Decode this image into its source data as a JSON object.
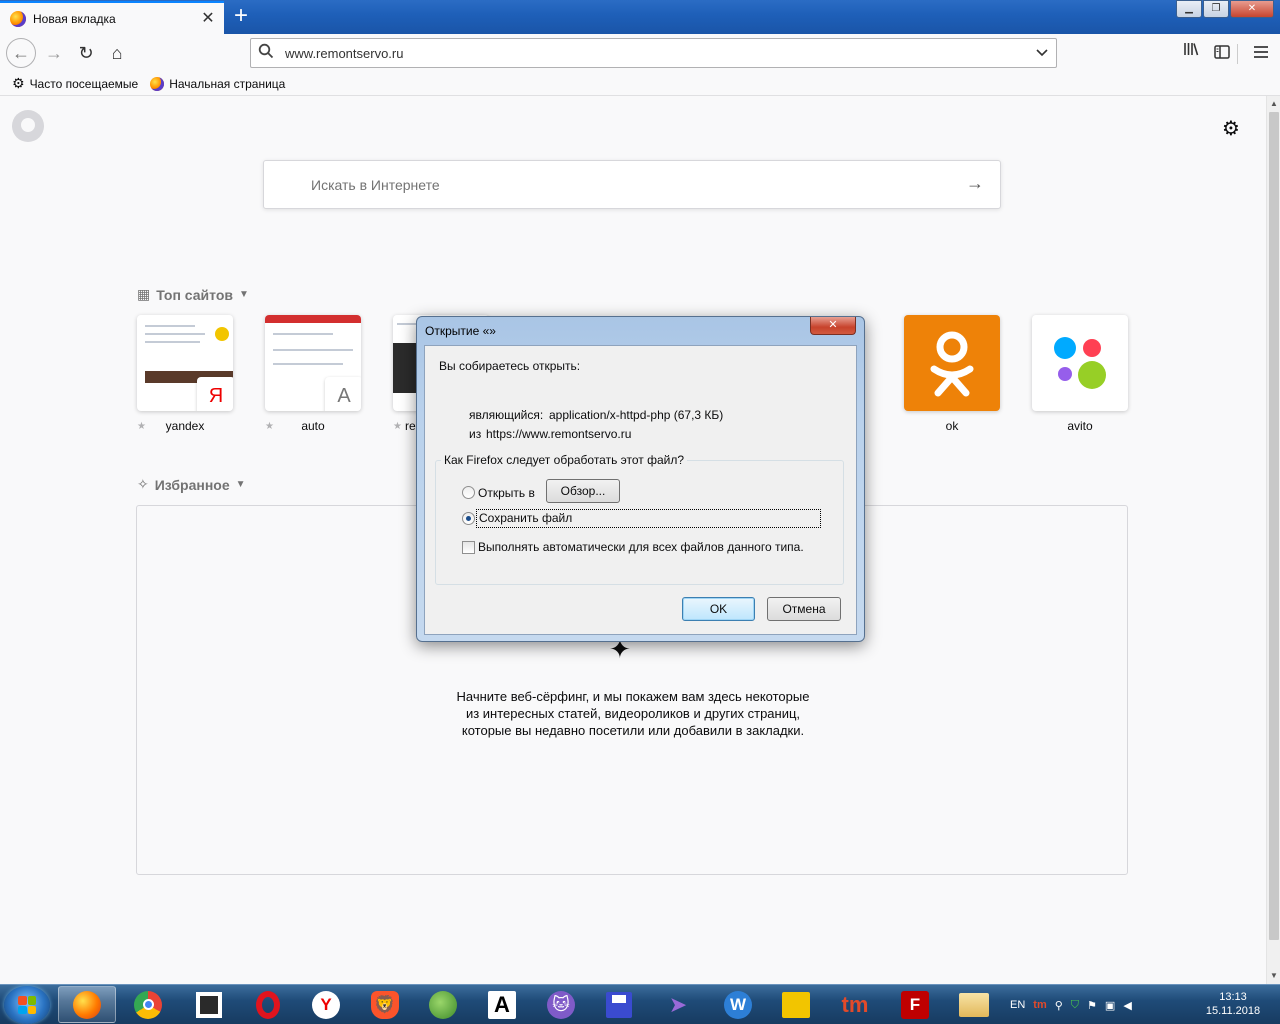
{
  "browser": {
    "tab_title": "Новая вкладка",
    "tab_close": "✕",
    "new_tab": "+",
    "url": "www.remontservo.ru",
    "bookmarks": [
      {
        "label": "Часто посещаемые",
        "icon": "gear-icon"
      },
      {
        "label": "Начальная страница",
        "icon": "firefox-icon"
      }
    ]
  },
  "newtab": {
    "search_placeholder": "Искать в Интернете",
    "top_sites_title": "Топ сайтов",
    "top_sites": [
      {
        "label": "yandex",
        "badge": "Я"
      },
      {
        "label": "auto",
        "badge": "A"
      },
      {
        "label": "re"
      },
      {
        "label": "ok"
      },
      {
        "label": "avito"
      }
    ],
    "favorites_title": "Избранное",
    "favorites_empty_text": "Начните веб-сёрфинг, и мы покажем вам здесь некоторые из интересных статей, видеороликов и других страниц, которые вы недавно посетили или добавили в закладки."
  },
  "dialog": {
    "title": "Открытие «»",
    "close": "✕",
    "heading": "Вы собираетесь открыть:",
    "type_label": "являющийся:",
    "type_value": "application/x-httpd-php (67,3 КБ)",
    "from_label": "из",
    "from_value": "https://www.remontservo.ru",
    "group_label": "Как Firefox следует обработать этот файл?",
    "open_with_label": "Открыть в",
    "browse_button": "Обзор...",
    "save_label": "Сохранить файл",
    "auto_label": "Выполнять автоматически для всех файлов данного типа.",
    "selected_option": "save",
    "auto_checked": false,
    "ok_button": "OK",
    "cancel_button": "Отмена"
  },
  "taskbar": {
    "items": [
      {
        "name": "firefox",
        "active": true,
        "color": "#ff7a00"
      },
      {
        "name": "chrome",
        "color": "#34a853"
      },
      {
        "name": "app-window",
        "color": "#ffffff"
      },
      {
        "name": "opera",
        "color": "#e0141e"
      },
      {
        "name": "yandex-browser",
        "color": "#ffffff"
      },
      {
        "name": "brave",
        "color": "#fb542b"
      },
      {
        "name": "globe-app",
        "color": "#5aa832"
      },
      {
        "name": "font-viewer",
        "color": "#ffffff"
      },
      {
        "name": "cat-app",
        "color": "#7f5bc8"
      },
      {
        "name": "save-app",
        "color": "#3a4bd0"
      },
      {
        "name": "tor-app",
        "color": "#7e4ac9"
      },
      {
        "name": "w-app",
        "color": "#2d7fd6"
      },
      {
        "name": "yellow-app",
        "color": "#f2c500"
      },
      {
        "name": "tm-app",
        "color": "#e24a2a"
      },
      {
        "name": "filezilla",
        "color": "#bf0000"
      },
      {
        "name": "explorer",
        "color": "#f0d58a"
      }
    ],
    "tm_label": "tm",
    "fz_label": "F",
    "w_label": "W",
    "y_label": "Y",
    "a_label": "A",
    "lang": "EN",
    "tray_tm": "tm",
    "time": "13:13",
    "date": "15.11.2018"
  }
}
